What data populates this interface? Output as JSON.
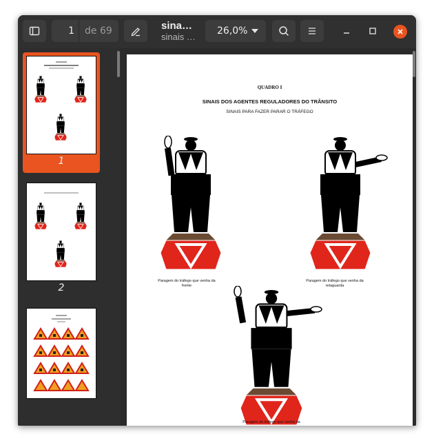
{
  "header": {
    "current_page": "1",
    "total_pages": "de 69",
    "title": "sina…",
    "subtitle": "sinais …",
    "zoom": "26,0%",
    "icons": [
      "sidebar-toggle-icon",
      "annotate-pen-icon",
      "zoom-caret-icon",
      "search-icon",
      "menu-icon",
      "minimize-icon",
      "maximize-icon",
      "close-icon"
    ]
  },
  "sidebar": {
    "thumbnails": [
      {
        "label": "1",
        "selected": true
      },
      {
        "label": "2",
        "selected": false
      },
      {
        "label": "",
        "selected": false
      }
    ],
    "footer_icons": [
      "thumbnails-grid-icon",
      "outline-icon",
      "annotations-icon",
      "bookmarks-icon"
    ]
  },
  "document": {
    "heading": "QUADRO I",
    "title": "SINAIS DOS AGENTES REGULADORES DO TRÂNSITO",
    "subtitle": "SINAIS PARA FAZER PARAR O TRÁFEGO",
    "caption1": "Paragem do tráfego que venha da frente",
    "caption2": "Paragem do tráfego que venha da retaguarda",
    "caption3": "Paragem do tráfego que venha da"
  },
  "colors": {
    "accent": "#e95420",
    "sign_red": "#e0251b",
    "pedestal": "#6b4a33"
  }
}
